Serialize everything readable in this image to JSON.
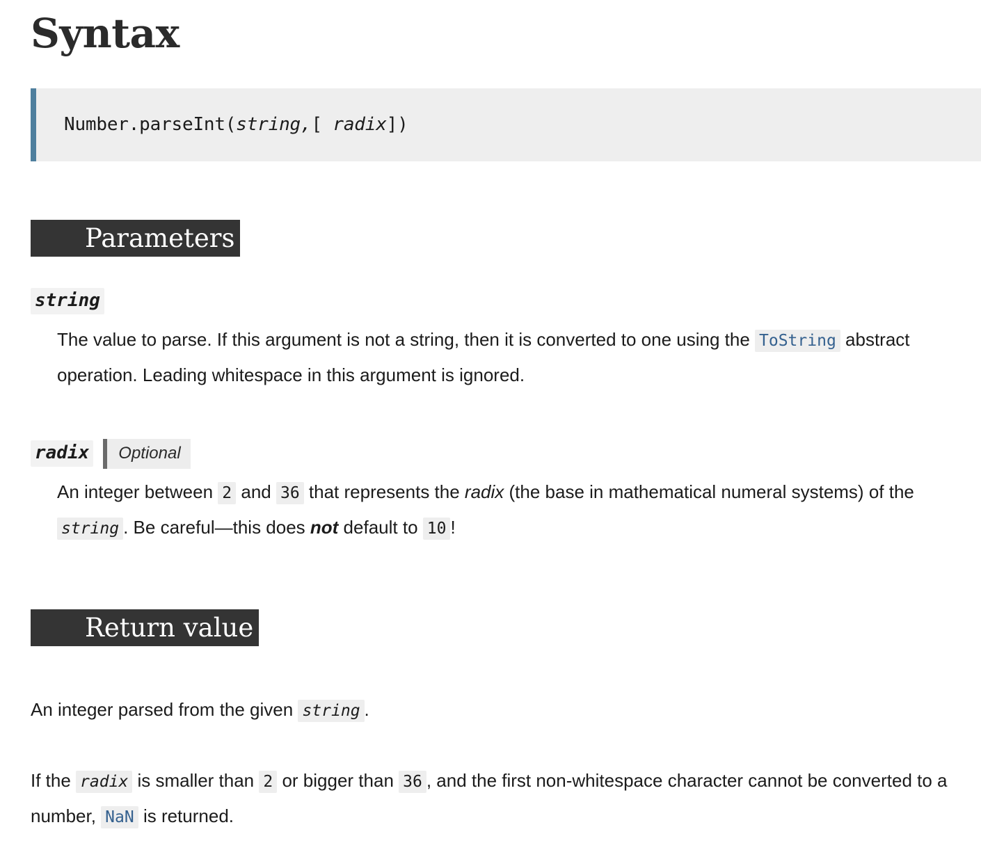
{
  "page": {
    "title": "Syntax"
  },
  "syntax": {
    "code_prefix": "Number.parseInt(",
    "code_param_1": "string,",
    "code_bracket_open": "[ ",
    "code_param_2": "radix",
    "code_bracket_close": "])"
  },
  "sections": {
    "parameters_heading": "Parameters",
    "return_value_heading": "Return value"
  },
  "parameters": [
    {
      "term": "string",
      "optional_badge": null,
      "description_parts": {
        "p1": "The value to parse. If this argument is not a string, then it is converted to one using the ",
        "code1": "ToString",
        "p2": " abstract operation. Leading whitespace in this argument is ignored."
      }
    },
    {
      "term": "radix",
      "optional_badge": "Optional",
      "description_parts": {
        "p1": "An integer between ",
        "code1": "2",
        "p2": " and ",
        "code2": "36",
        "p3": " that represents the ",
        "em1": "radix",
        "p4": " (the base in mathematical numeral systems) of the ",
        "code3": "string",
        "p5": ". Be careful—this does ",
        "strong1": "not",
        "p6": " default to ",
        "code4": "10",
        "p7": "!"
      }
    }
  ],
  "return_value": {
    "paragraph_1": {
      "p1": "An integer parsed from the given ",
      "code1": "string",
      "p2": "."
    },
    "paragraph_2": {
      "p1": "If the ",
      "code1": "radix",
      "p2": " is smaller than ",
      "code2": "2",
      "p3": " or bigger than ",
      "code3": "36",
      "p4": ", and the first non-whitespace character cannot be converted to a number, ",
      "code4": "NaN",
      "p5": " is returned."
    }
  },
  "colors": {
    "code_block_background": "#eeeeee",
    "code_block_accent": "#4f7f9e",
    "section_heading_background": "#343434",
    "section_heading_text": "#ffffff",
    "inline_code_background": "#eeeeee",
    "inline_code_link_text": "#35618f",
    "optional_badge_background": "#ededed",
    "optional_badge_accent": "#6b6b6b",
    "body_text": "#1b1b1b"
  }
}
